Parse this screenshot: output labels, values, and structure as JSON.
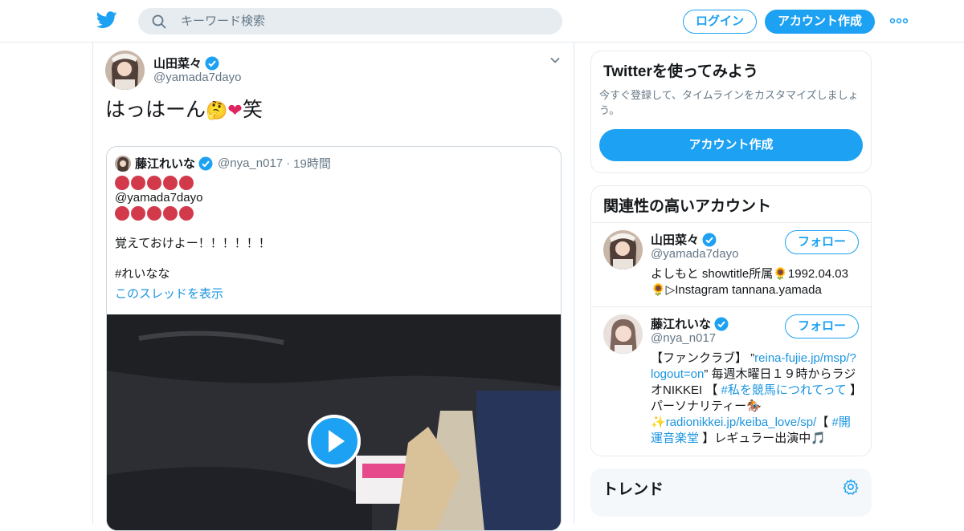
{
  "header": {
    "search_placeholder": "キーワード検索",
    "login_label": "ログイン",
    "signup_label": "アカウント作成"
  },
  "tweet": {
    "author_name": "山田菜々",
    "author_handle": "@yamada7dayo",
    "text_main": "はっはーん",
    "text_tail": "笑",
    "text_emojis": [
      "🤔",
      "❤"
    ],
    "quote": {
      "author_name": "藤江れいな",
      "author_handle": "@nya_n017",
      "separator": "·",
      "time": "19時間",
      "mention": "@yamada7dayo",
      "line1": "覚えておけよー！！！！！！",
      "hashtag": "#れいなな",
      "show_thread": "このスレッドを表示"
    }
  },
  "sidebar": {
    "try_card": {
      "title": "Twitterを使ってみよう",
      "description": "今すぐ登録して、タイムラインをカスタマイズしましょう。",
      "signup_label": "アカウント作成"
    },
    "related": {
      "title": "関連性の高いアカウント",
      "follow_label": "フォロー",
      "accounts": [
        {
          "name": "山田菜々",
          "handle": "@yamada7dayo",
          "bio": "よしもと showtitle所属🌻1992.04.03🌻▷Instagram tannana.yamada"
        },
        {
          "name": "藤江れいな",
          "handle": "@nya_n017",
          "bio_1": "【ファンクラブ】 ”",
          "bio_link1": "reina-fujie.jp/msp/?logout=on",
          "bio_2": "” 毎週木曜日１９時からラジオNIKKEI 【",
          "bio_link2": "#私を競馬につれてって",
          "bio_3": "】パーソナリティー🏇✨",
          "bio_link3": "radionikkei.jp/keiba_love/sp/",
          "bio_4": "【",
          "bio_link4": "#開運音楽堂",
          "bio_5": "】レギュラー出演中🎵"
        }
      ]
    },
    "trends": {
      "title": "トレンド"
    }
  },
  "colors": {
    "accent": "#1da1f2",
    "link": "#1b95e0",
    "muted": "#657786",
    "border": "#e6ecf0"
  }
}
